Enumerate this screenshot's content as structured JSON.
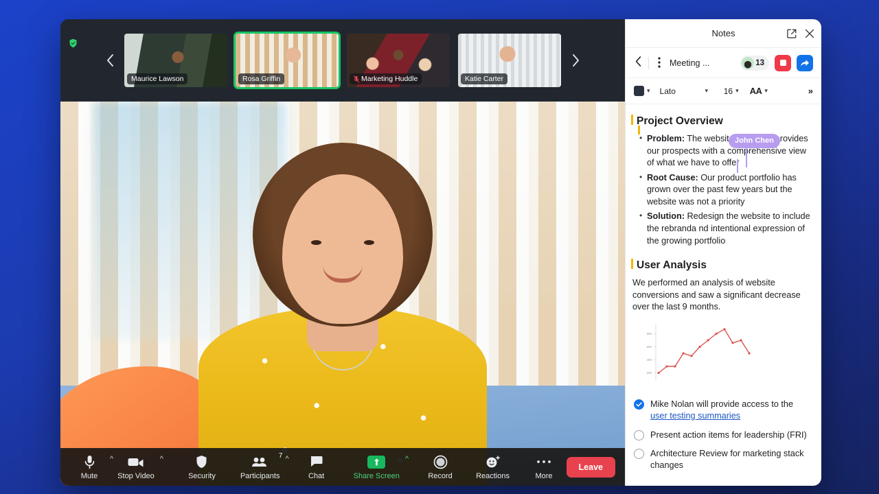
{
  "meeting": {
    "encryption_icon": "green-shield-check-icon",
    "filmstrip": {
      "prev_icon": "chevron-left-icon",
      "next_icon": "chevron-right-icon",
      "participants": [
        {
          "name": "Maurice Lawson",
          "active": false,
          "muted": false
        },
        {
          "name": "Rosa Griffin",
          "active": true,
          "muted": false
        },
        {
          "name": "Marketing Huddle",
          "active": false,
          "muted": true
        },
        {
          "name": "Katie Carter",
          "active": false,
          "muted": false
        }
      ]
    },
    "controls": [
      {
        "label": "Mute",
        "icon": "microphone-icon",
        "caret": true
      },
      {
        "label": "Stop Video",
        "icon": "video-camera-icon",
        "caret": true
      },
      {
        "label": "Security",
        "icon": "shield-icon",
        "caret": false
      },
      {
        "label": "Participants",
        "icon": "people-icon",
        "caret": true,
        "badge": "7"
      },
      {
        "label": "Chat",
        "icon": "chat-bubble-icon",
        "caret": false
      },
      {
        "label": "Share Screen",
        "icon": "share-screen-icon",
        "caret": true,
        "highlight": true
      },
      {
        "label": "Record",
        "icon": "record-circle-icon",
        "caret": false
      },
      {
        "label": "Reactions",
        "icon": "smiley-plus-icon",
        "caret": false
      },
      {
        "label": "More",
        "icon": "ellipsis-icon",
        "caret": false
      }
    ],
    "leave_label": "Leave"
  },
  "notes": {
    "title": "Notes",
    "popout_icon": "open-in-new-icon",
    "close_icon": "close-icon",
    "toolbar": {
      "back_icon": "chevron-left-icon",
      "kebab_icon": "more-vertical-icon",
      "note_name": "Meeting ...",
      "collaborator_count": "13",
      "avatar_icon": "avatar-icon",
      "record_icon": "stop-record-icon",
      "share_icon": "share-arrow-icon"
    },
    "format_toolbar": {
      "color_swatch": "#2b3240",
      "font_family": "Lato",
      "font_size": "16",
      "text_style_icon": "AA",
      "overflow_icon": "»"
    },
    "collaborator_cursor": {
      "name": "John Chen",
      "color": "#b79cf0"
    },
    "sections": [
      {
        "heading": "Project Overview",
        "bullets": [
          {
            "label": "Problem:",
            "text": " The website no longer provides our prospects with a comprehensive view of what we have to offer"
          },
          {
            "label": "Root Cause:",
            "text": " Our product portfolio has grown over the past few years but the website was not a priority"
          },
          {
            "label": "Solution:",
            "text": " Redesign the website to include the rebranda nd intentional expression of the growing portfolio"
          }
        ]
      },
      {
        "heading": "User Analysis",
        "paragraph": "We performed an analysis of website conversions and saw a significant decrease over the last 9 months."
      }
    ],
    "checklist": [
      {
        "checked": true,
        "text": "Mike Nolan will provide access to the ",
        "link": "user testing summaries"
      },
      {
        "checked": false,
        "text": "Present action items for leadership (FRI)",
        "link": ""
      },
      {
        "checked": false,
        "text": "Architecture Review for marketing stack changes",
        "link": ""
      }
    ]
  },
  "chart_data": {
    "type": "line",
    "title": "",
    "xlabel": "",
    "ylabel": "",
    "color": "#d9534f",
    "grid": false,
    "legend": "none",
    "ylim": [
      100,
      900
    ],
    "yticks": [
      200,
      400,
      600,
      800
    ],
    "ytick_labels": [
      "200",
      "400",
      "600",
      "800"
    ],
    "x": [
      1,
      2,
      3,
      4,
      5,
      6,
      7,
      8,
      9,
      10,
      11,
      12,
      13
    ],
    "values": [
      200,
      300,
      300,
      500,
      460,
      600,
      700,
      800,
      870,
      660,
      700,
      500
    ]
  }
}
